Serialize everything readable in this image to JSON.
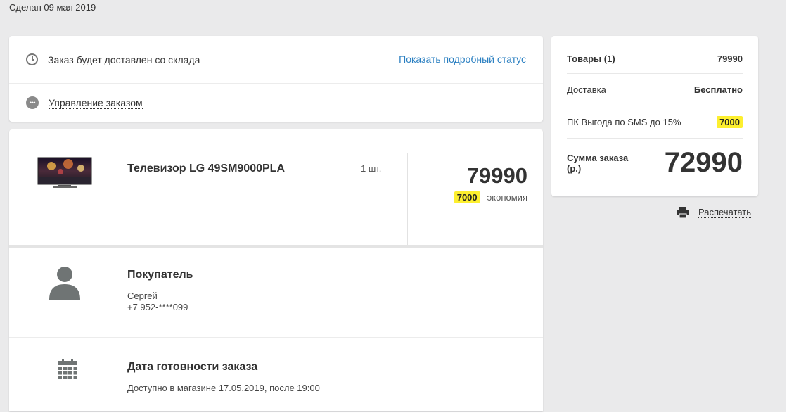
{
  "order": {
    "made_date": "Сделан 09 мая 2019"
  },
  "status": {
    "delivery_text": "Заказ будет доставлен со склада",
    "details_link": "Показать подробный статус",
    "manage_link": "Управление заказом"
  },
  "product": {
    "name": "Телевизор LG 49SM9000PLA",
    "qty": "1 шт.",
    "price": "79990",
    "saving_value": "7000",
    "saving_label": "экономия"
  },
  "buyer": {
    "title": "Покупатель",
    "name": "Сергей",
    "phone": "+7 952-****099"
  },
  "ready": {
    "title": "Дата готовности заказа",
    "text": "Доступно в магазине 17.05.2019, после 19:00"
  },
  "summary": {
    "goods_label": "Товары (1)",
    "goods_value": "79990",
    "delivery_label": "Доставка",
    "delivery_value": "Бесплатно",
    "promo_label": "ПК Выгода по SMS до 15%",
    "promo_value": "7000",
    "total_label": "Сумма заказа (р.)",
    "total_value": "72990"
  },
  "print": {
    "label": "Распечатать"
  },
  "colors": {
    "accent_link": "#2a7fc1",
    "highlight": "#fdef2f",
    "background": "#eaeaeb"
  }
}
